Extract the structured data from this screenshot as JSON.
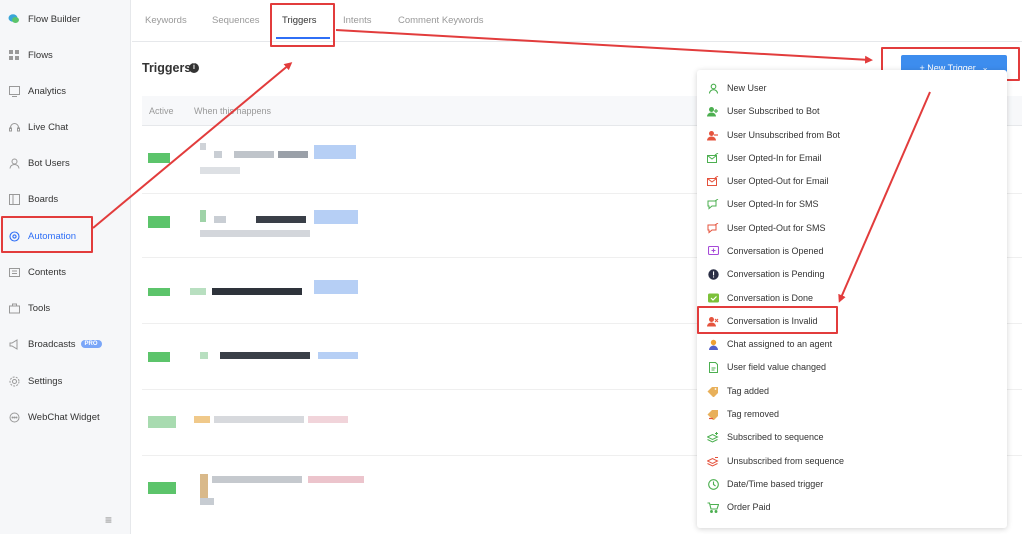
{
  "sidebar": {
    "items": [
      {
        "label": "Flow Builder",
        "icon": "chat-bubble-icon"
      },
      {
        "label": "Flows",
        "icon": "grid-icon"
      },
      {
        "label": "Analytics",
        "icon": "analytics-icon"
      },
      {
        "label": "Live Chat",
        "icon": "headset-icon"
      },
      {
        "label": "Bot Users",
        "icon": "user-icon"
      },
      {
        "label": "Boards",
        "icon": "board-icon"
      },
      {
        "label": "Automation",
        "icon": "automation-icon"
      },
      {
        "label": "Contents",
        "icon": "contents-icon"
      },
      {
        "label": "Tools",
        "icon": "tools-icon"
      },
      {
        "label": "Broadcasts",
        "icon": "megaphone-icon",
        "badge": "PRO"
      },
      {
        "label": "Settings",
        "icon": "gear-icon"
      },
      {
        "label": "WebChat Widget",
        "icon": "webchat-icon"
      }
    ],
    "collapse_icon": "menu-icon"
  },
  "tabs": [
    "Keywords",
    "Sequences",
    "Triggers",
    "Intents",
    "Comment Keywords"
  ],
  "active_tab": "Triggers",
  "main": {
    "title": "Triggers",
    "columns": [
      "Active",
      "When this happens"
    ]
  },
  "new_trigger_button": {
    "label": "+ New Trigger",
    "chevron": "chevron-down-icon"
  },
  "dropdown": {
    "items": [
      {
        "label": "New User",
        "icon": "user-outline-icon",
        "color": "#4caf50"
      },
      {
        "label": "User Subscribed to Bot",
        "icon": "user-plus-icon",
        "color": "#4caf50"
      },
      {
        "label": "User Unsubscribed from Bot",
        "icon": "user-minus-icon",
        "color": "#e5533d"
      },
      {
        "label": "User Opted-In for Email",
        "icon": "email-in-icon",
        "color": "#4caf50"
      },
      {
        "label": "User Opted-Out for Email",
        "icon": "email-out-icon",
        "color": "#e5533d"
      },
      {
        "label": "User Opted-In for SMS",
        "icon": "sms-in-icon",
        "color": "#4caf50"
      },
      {
        "label": "User Opted-Out for SMS",
        "icon": "sms-out-icon",
        "color": "#e5533d"
      },
      {
        "label": "Conversation is Opened",
        "icon": "chat-plus-icon",
        "color": "#a64ad8"
      },
      {
        "label": "Conversation is Pending",
        "icon": "alert-circle-icon",
        "color": "#2b2f45"
      },
      {
        "label": "Conversation is Done",
        "icon": "chat-check-icon",
        "color": "#7cc13a"
      },
      {
        "label": "Conversation is Invalid",
        "icon": "user-x-icon",
        "color": "#e5533d"
      },
      {
        "label": "Chat assigned to an agent",
        "icon": "agent-icon",
        "color": "#f0a030"
      },
      {
        "label": "User field value changed",
        "icon": "doc-edit-icon",
        "color": "#4caf50"
      },
      {
        "label": "Tag added",
        "icon": "tag-plus-icon",
        "color": "#e8b05a"
      },
      {
        "label": "Tag removed",
        "icon": "tag-minus-icon",
        "color": "#e8b05a"
      },
      {
        "label": "Subscribed to sequence",
        "icon": "layers-plus-icon",
        "color": "#4caf50"
      },
      {
        "label": "Unsubscribed from sequence",
        "icon": "layers-minus-icon",
        "color": "#e5533d"
      },
      {
        "label": "Date/Time based trigger",
        "icon": "clock-icon",
        "color": "#4caf50"
      },
      {
        "label": "Order Paid",
        "icon": "cart-icon",
        "color": "#4caf50"
      }
    ]
  },
  "colors": {
    "accent": "#2f6ff6",
    "button": "#3d8dee",
    "annotation": "#e23c3c"
  }
}
